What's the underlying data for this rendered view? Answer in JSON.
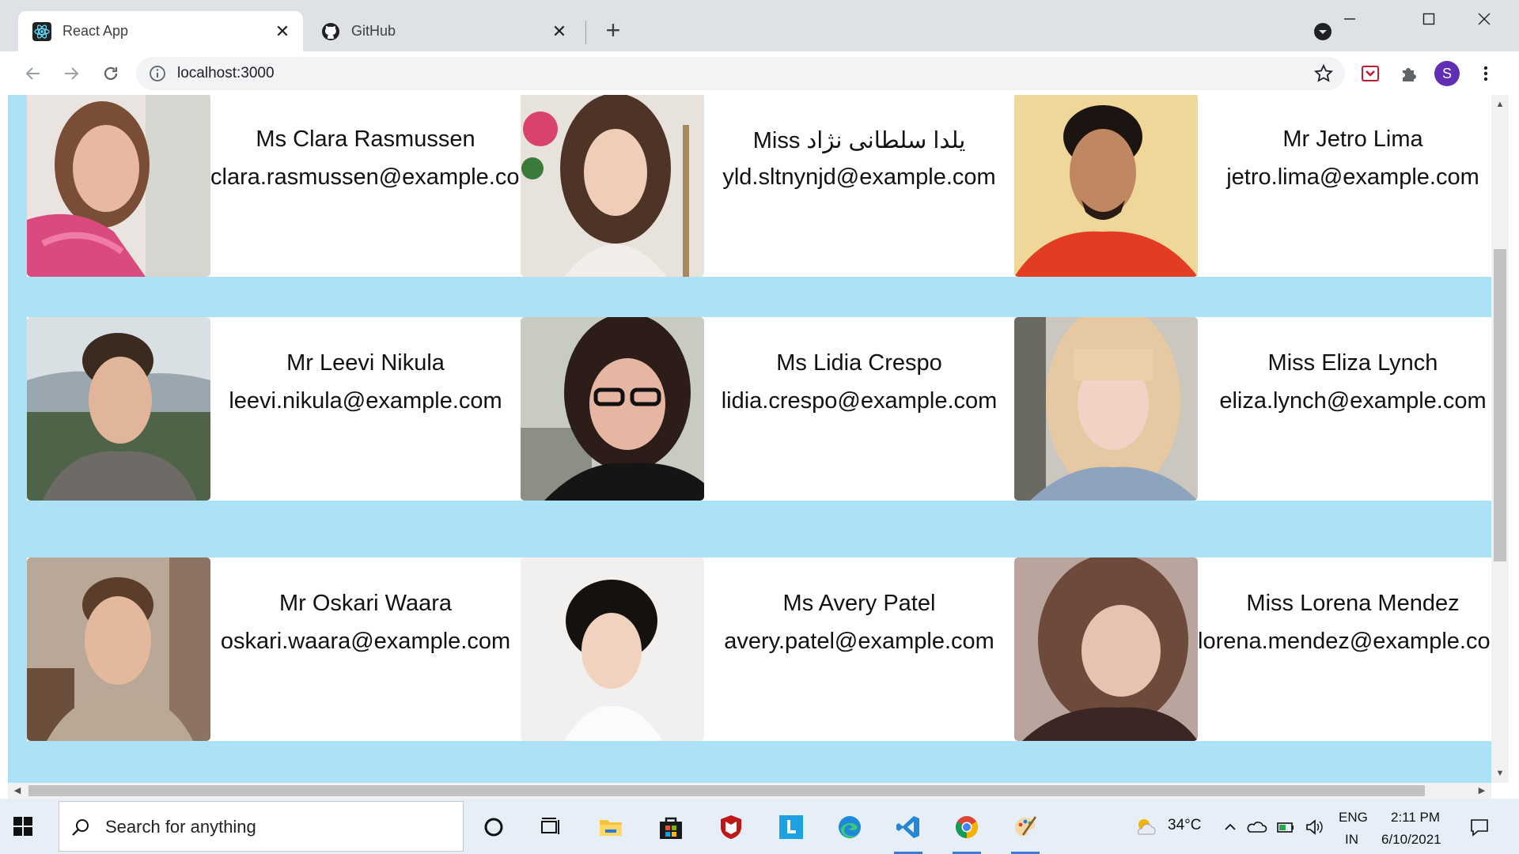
{
  "browser": {
    "tabs": [
      {
        "title": "React App",
        "active": true,
        "icon": "react-icon"
      },
      {
        "title": "GitHub",
        "active": false,
        "icon": "github-icon"
      }
    ],
    "address": "localhost:3000",
    "profile_initial": "S"
  },
  "page": {
    "background": "#ade2f6",
    "rows": [
      [
        {
          "name": "Ms Clara Rasmussen",
          "email": "clara.rasmussen@example.com",
          "photo_bg": "#c98a8e"
        },
        {
          "name": "Miss یلدا سلطانی نژاد",
          "email": "yld.sltnynjd@example.com",
          "photo_bg": "#b7a79a"
        },
        {
          "name": "Mr Jetro Lima",
          "email": "jetro.lima@example.com",
          "photo_bg": "#d9643a"
        }
      ],
      [
        {
          "name": "Mr Leevi Nikula",
          "email": "leevi.nikula@example.com",
          "photo_bg": "#8b9a93"
        },
        {
          "name": "Ms Lidia Crespo",
          "email": "lidia.crespo@example.com",
          "photo_bg": "#6e6b62"
        },
        {
          "name": "Miss Eliza Lynch",
          "email": "eliza.lynch@example.com",
          "photo_bg": "#c4b49d"
        }
      ],
      [
        {
          "name": "Mr Oskari Waara",
          "email": "oskari.waara@example.com",
          "photo_bg": "#a99584"
        },
        {
          "name": "Ms Avery Patel",
          "email": "avery.patel@example.com",
          "photo_bg": "#e8e6e3"
        },
        {
          "name": "Miss Lorena Mendez",
          "email": "lorena.mendez@example.com",
          "photo_bg": "#7a6660"
        }
      ]
    ]
  },
  "taskbar": {
    "search_placeholder": "Search for anything",
    "weather": "34°C",
    "lang_top": "ENG",
    "lang_bottom": "IN",
    "time": "2:11 PM",
    "date": "6/10/2021"
  }
}
